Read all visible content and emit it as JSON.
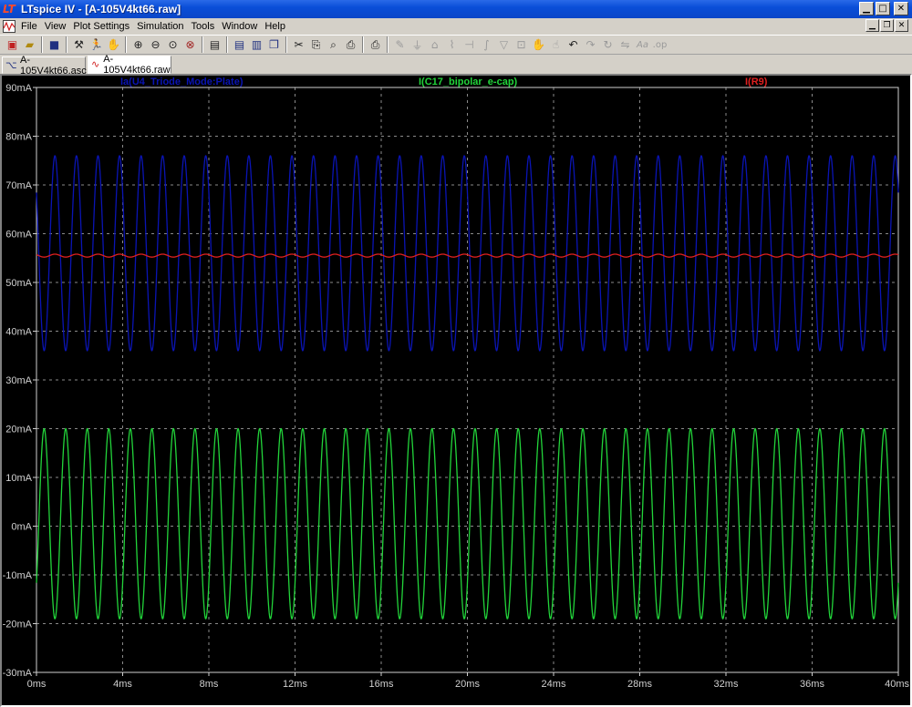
{
  "window": {
    "title": "LTspice IV - [A-105V4kt66.raw]",
    "app_icon": "ltspice-logo-icon",
    "buttons": [
      "minimize",
      "maximize",
      "close"
    ]
  },
  "menu": {
    "items": [
      "File",
      "View",
      "Plot Settings",
      "Simulation",
      "Tools",
      "Window",
      "Help"
    ]
  },
  "toolbar": {
    "icons": [
      "new-schematic-icon",
      "open-icon",
      "save-icon",
      "control-panel-icon",
      "run-icon",
      "pan-icon",
      "zoom-in-icon",
      "zoom-out-icon",
      "zoom-area-icon",
      "zoom-cancel-icon",
      "autorange-icon",
      "tile-horizontal-icon",
      "tile-vertical-icon",
      "cascade-icon",
      "cut-icon",
      "copy-icon",
      "find-icon",
      "print-preview-icon",
      "print-icon",
      "wire-icon",
      "ground-icon",
      "label-icon",
      "resistor-icon",
      "capacitor-icon",
      "inductor-icon",
      "diode-icon",
      "component-icon",
      "move-icon",
      "drag-icon",
      "undo-icon",
      "redo-icon",
      "rotate-icon",
      "mirror-icon",
      "text-icon",
      "spice-directive-icon"
    ]
  },
  "tabs": [
    {
      "label": "A-105V4kt66.asc",
      "icon": "schematic-icon",
      "active": false
    },
    {
      "label": "A-105V4kt66.raw",
      "icon": "waveform-icon",
      "active": true
    }
  ],
  "chart_data": {
    "type": "line",
    "title": "",
    "xlabel": "",
    "ylabel": "",
    "xlim": [
      0,
      40
    ],
    "ylim": [
      -30,
      90
    ],
    "x_unit": "ms",
    "y_unit": "mA",
    "x_ticks": [
      "0ms",
      "4ms",
      "8ms",
      "12ms",
      "16ms",
      "20ms",
      "24ms",
      "28ms",
      "32ms",
      "36ms",
      "40ms"
    ],
    "y_ticks": [
      "90mA",
      "80mA",
      "70mA",
      "60mA",
      "50mA",
      "40mA",
      "30mA",
      "20mA",
      "10mA",
      "0mA",
      "-10mA",
      "-20mA",
      "-30mA"
    ],
    "grid": true,
    "legend_position": "top",
    "background": "#000000",
    "frequency_khz": 1,
    "series": [
      {
        "name": "Ia(U4_Triode_Mode:Plate)",
        "color": "#0a14b4",
        "kind": "sine",
        "offset": 56,
        "amplitude": 20,
        "min": 36,
        "max": 76
      },
      {
        "name": "I(C17_bipolar_e-cap)",
        "color": "#22d43a",
        "kind": "sine",
        "offset": 0.5,
        "amplitude": 19.5,
        "min": -19,
        "max": 20
      },
      {
        "name": "I(R9)",
        "color": "#e02020",
        "kind": "sine",
        "offset": 55.5,
        "amplitude": 0.3,
        "min": 55.2,
        "max": 55.8
      }
    ]
  }
}
